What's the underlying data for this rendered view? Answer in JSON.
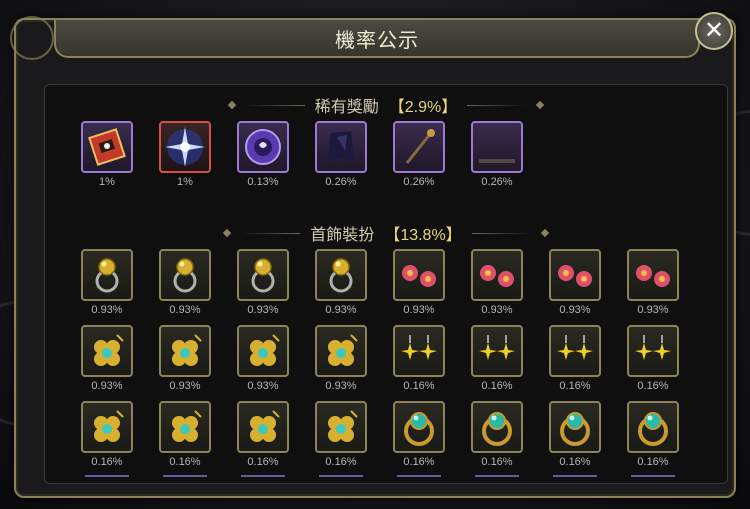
{
  "title": "機率公示",
  "close_label": "✕",
  "rare": {
    "title": "稀有獎勵",
    "pct": "【2.9%】",
    "items": [
      {
        "name": "red-card-icon",
        "pct": "1%",
        "frame": "purple"
      },
      {
        "name": "star-burst-icon",
        "pct": "1%",
        "frame": "red"
      },
      {
        "name": "purple-orb-icon",
        "pct": "0.13%",
        "frame": "purple"
      },
      {
        "name": "dark-cloak-icon",
        "pct": "0.26%",
        "frame": "purple"
      },
      {
        "name": "staff-icon",
        "pct": "0.26%",
        "frame": "purple"
      },
      {
        "name": "purple-aura-icon",
        "pct": "0.26%",
        "frame": "purple"
      }
    ]
  },
  "jewelry": {
    "title": "首飾裝扮",
    "pct": "【13.8%】",
    "rows": [
      [
        {
          "name": "gold-ring-icon",
          "pct": "0.93%"
        },
        {
          "name": "gold-ring-icon",
          "pct": "0.93%"
        },
        {
          "name": "gold-ring-icon",
          "pct": "0.93%"
        },
        {
          "name": "gold-ring-icon",
          "pct": "0.93%"
        },
        {
          "name": "red-flower-earrings-icon",
          "pct": "0.93%"
        },
        {
          "name": "red-flower-earrings-icon",
          "pct": "0.93%"
        },
        {
          "name": "red-flower-earrings-icon",
          "pct": "0.93%"
        },
        {
          "name": "red-flower-earrings-icon",
          "pct": "0.93%"
        }
      ],
      [
        {
          "name": "clover-earring-icon",
          "pct": "0.93%"
        },
        {
          "name": "clover-earring-icon",
          "pct": "0.93%"
        },
        {
          "name": "clover-earring-icon",
          "pct": "0.93%"
        },
        {
          "name": "clover-earring-icon",
          "pct": "0.93%"
        },
        {
          "name": "star-earrings-icon",
          "pct": "0.16%"
        },
        {
          "name": "star-earrings-icon",
          "pct": "0.16%"
        },
        {
          "name": "star-earrings-icon",
          "pct": "0.16%"
        },
        {
          "name": "star-earrings-icon",
          "pct": "0.16%"
        }
      ],
      [
        {
          "name": "clover-earring-icon",
          "pct": "0.16%"
        },
        {
          "name": "clover-earring-icon",
          "pct": "0.16%"
        },
        {
          "name": "clover-earring-icon",
          "pct": "0.16%"
        },
        {
          "name": "clover-earring-icon",
          "pct": "0.16%"
        },
        {
          "name": "turquoise-ring-icon",
          "pct": "0.16%"
        },
        {
          "name": "turquoise-ring-icon",
          "pct": "0.16%"
        },
        {
          "name": "turquoise-ring-icon",
          "pct": "0.16%"
        },
        {
          "name": "turquoise-ring-icon",
          "pct": "0.16%"
        }
      ]
    ]
  }
}
